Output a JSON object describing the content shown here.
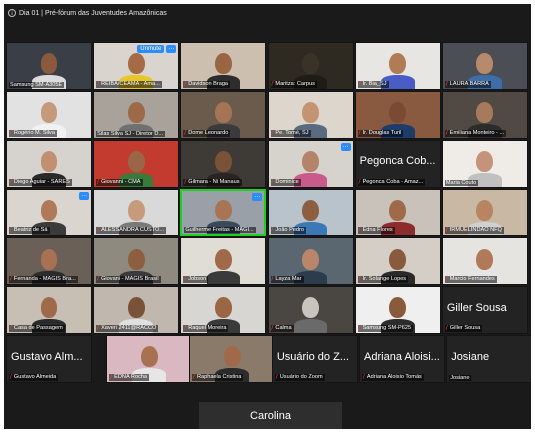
{
  "window": {
    "info_icon": "info-icon",
    "title": "Dia 01 | Pré-fórum das Juventudes Amazônicas"
  },
  "colors": {
    "talking_border": "#1fd11f",
    "muted_mic": "#ff3b3b",
    "accent_blue": "#2d8cff",
    "background": "#1a1a1a"
  },
  "participants": [
    {
      "name": "Samsung SM-A305E",
      "muted": false,
      "bg": "#3a3f47",
      "skin": "#8a5a3c",
      "shirt": "#dcdcdc"
    },
    {
      "name": "REIBA/CEAMA - Ama...",
      "muted": true,
      "bg": "#d9d4ce",
      "skin": "#a56b46",
      "shirt": "#e9c628",
      "unmute_label": "Unmute",
      "more": true
    },
    {
      "name": "Davidson Braga",
      "muted": true,
      "bg": "#cdbfb0",
      "skin": "#9a6642",
      "shirt": "#2d2d2d"
    },
    {
      "name": "Maritza: Carpus",
      "muted": true,
      "bg": "#2e2a22",
      "skin": "#3a3226",
      "shirt": "#1f1b16"
    },
    {
      "name": "Ir. Bia_SJ",
      "muted": true,
      "bg": "#e8e6e2",
      "skin": "#b07b55",
      "shirt": "#4a5dc6"
    },
    {
      "name": "LAURA BARRA",
      "muted": true,
      "bg": "#4b4e55",
      "skin": "#b88a6c",
      "shirt": "#3d6ea8"
    },
    {
      "name": "Rogério M. Silva",
      "muted": true,
      "bg": "#e2e2e2",
      "skin": "#c49a7b",
      "shirt": "#f1f1f1"
    },
    {
      "name": "Silas Silva SJ - Diretor D...",
      "muted": false,
      "bg": "#a8a29a",
      "skin": "#9c6a48",
      "shirt": "#707070"
    },
    {
      "name": "Dome Leonardo",
      "muted": true,
      "bg": "#6b5b4c",
      "skin": "#a57456",
      "shirt": "#3b3b3b"
    },
    {
      "name": "Pe. Tomé, SJ",
      "muted": true,
      "bg": "#dcd6cd",
      "skin": "#c49472",
      "shirt": "#5a6a80"
    },
    {
      "name": "Ir. Douglas Turil",
      "muted": true,
      "bg": "#8a5a40",
      "skin": "#7a4b32",
      "shirt": "#1e3d6c"
    },
    {
      "name": "Emiliana Monteiro - ...",
      "muted": true,
      "bg": "#514a44",
      "skin": "#a87a5c",
      "shirt": "#2c2c2c"
    },
    {
      "name": "Diego Aguiar - SARES",
      "muted": true,
      "bg": "#d6d3cf",
      "skin": "#c09070",
      "shirt": "#2a2a2a"
    },
    {
      "name": "Giovanni - CMA",
      "muted": true,
      "bg": "#c23b2e",
      "skin": "#9b6648",
      "shirt": "#3a7a3a"
    },
    {
      "name": "Gilmara - Ni Manaus",
      "muted": true,
      "bg": "#3e3a36",
      "skin": "#7a5238",
      "shirt": "#2a2420"
    },
    {
      "name": "Dominice",
      "muted": true,
      "bg": "#d6d2cc",
      "skin": "#b5836a",
      "shirt": "#c85b8a",
      "more": true
    },
    {
      "name": "Pegonca Coba - Amaz...",
      "muted": true,
      "big": "Pegonca Cob...",
      "bg": "#232323"
    },
    {
      "name": "Maria Couto",
      "muted": false,
      "bg": "#efece8",
      "skin": "#c4947a",
      "shirt": "#c0c0c0"
    },
    {
      "name": "Beatriz de Sá",
      "muted": true,
      "bg": "#dad5ce",
      "skin": "#b07a58",
      "shirt": "#3b3b3b",
      "more": true
    },
    {
      "name": "ALESSANDRA CUSTO...",
      "muted": true,
      "bg": "#d9d9d9",
      "skin": "#c69a7a",
      "shirt": "#7a7a7a"
    },
    {
      "name": "Guilherme Freitas - MAGI...",
      "muted": false,
      "bg": "#9aa0a8",
      "skin": "#a87454",
      "shirt": "#3a4a5a",
      "talking": true,
      "more": true
    },
    {
      "name": "João Pedro",
      "muted": true,
      "bg": "#b8c3cc",
      "skin": "#8d5e40",
      "shirt": "#3a78b6"
    },
    {
      "name": "Edna Flores",
      "muted": true,
      "bg": "#c8c2bb",
      "skin": "#a06a4a",
      "shirt": "#8c2c2c"
    },
    {
      "name": "IRMUELINDÃO NFQ",
      "muted": true,
      "bg": "#c9b9a4",
      "skin": "#b98462",
      "shirt": "#d0d0d0"
    },
    {
      "name": "Fernanda - MAGIS Bra...",
      "muted": true,
      "bg": "#6a6058",
      "skin": "#a87252",
      "shirt": "#2b2b2b"
    },
    {
      "name": "Giovani - MAGIS Brasil",
      "muted": true,
      "bg": "#8f8a80",
      "skin": "#8d5e40",
      "shirt": "#3a3a3a"
    },
    {
      "name": "Jobson",
      "muted": true,
      "bg": "#e0dcd6",
      "skin": "#a06a4a",
      "shirt": "#3a3a3a"
    },
    {
      "name": "Layza Mar",
      "muted": true,
      "bg": "#5a6670",
      "skin": "#b9866a",
      "shirt": "#2c3c4c"
    },
    {
      "name": "Ir. Solange Lopes",
      "muted": true,
      "bg": "#d4cec6",
      "skin": "#8a5a3e",
      "shirt": "#2a2a2a"
    },
    {
      "name": "Marcio Fernandes",
      "muted": true,
      "bg": "#e6e4e0",
      "skin": "#b07a58",
      "shirt": "#e5e5e5"
    },
    {
      "name": "Casa de Passagem",
      "muted": true,
      "bg": "#c7bfb4",
      "skin": "#a06a4a",
      "shirt": "#2b2b2b"
    },
    {
      "name": "Xaveri 2411@RACCO",
      "muted": true,
      "bg": "#c0b8ae",
      "skin": "#7a5238",
      "shirt": "#e0e0e0"
    },
    {
      "name": "Raquel Moreira",
      "muted": true,
      "bg": "#d8d6d2",
      "skin": "#9a6644",
      "shirt": "#3a3a3a"
    },
    {
      "name": "Calma",
      "muted": true,
      "bg": "#4a4642",
      "skin": "#c9c4bc",
      "shirt": "#6a6a6a"
    },
    {
      "name": "Samsung SM-P625",
      "muted": true,
      "bg": "#efefef",
      "skin": "#8a5a3c",
      "shirt": "#2c2c2c"
    },
    {
      "name": "Giller Sousa",
      "muted": true,
      "big": "Giller Sousa",
      "bg": "#232323"
    },
    {
      "name": "Gustavo Almeida",
      "muted": true,
      "big": "Gustavo Alm...",
      "bg": "#232323"
    },
    {
      "name": "EDNA Rocha",
      "muted": true,
      "bg": "#d9b8c2",
      "skin": "#a87252",
      "shirt": "#e6e6e6"
    },
    {
      "name": "Raphaela Cristina",
      "muted": true,
      "bg": "#8a7a6a",
      "skin": "#a06a4a",
      "shirt": "#2b2b2b"
    },
    {
      "name": "Usuário do Zoom",
      "muted": true,
      "big": "Usuário do Z...",
      "bg": "#232323"
    },
    {
      "name": "Adriana Aloisio Tomás",
      "muted": true,
      "big": "Adriana Aloisi...",
      "bg": "#232323"
    },
    {
      "name": "Josiane",
      "muted": false,
      "big": "Josiane",
      "bg": "#232323"
    }
  ],
  "pager": {
    "name": "Carolina"
  }
}
